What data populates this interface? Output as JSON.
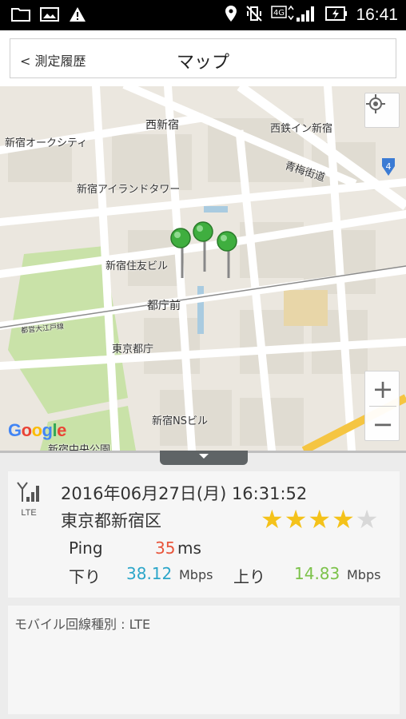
{
  "status_bar": {
    "time": "16:41",
    "network": "4G",
    "left_icons": [
      "folder-icon",
      "image-icon",
      "warning-icon"
    ],
    "right_icons": [
      "location-icon",
      "vibrate-icon",
      "signal-icon",
      "battery-charging-icon"
    ]
  },
  "header": {
    "back_label": "< 測定履歴",
    "title": "マップ"
  },
  "map": {
    "labels": [
      "西新宿",
      "西鉄イン新宿",
      "新宿オークシティ",
      "青梅街道",
      "新宿アイランドタワー",
      "新宿住友ビル",
      "都庁前",
      "都営大江戸線",
      "東京都庁",
      "新宿NSビル",
      "新宿中央公園"
    ],
    "route_badge": "4",
    "pin_count": 3,
    "zoom_in": "+",
    "zoom_out": "−",
    "attribution": "Google",
    "colors": {
      "pin": "#3fae3f",
      "park": "#c9e2a8",
      "road": "#ffffff"
    }
  },
  "result": {
    "network_type": "LTE",
    "datetime": "2016年06月27日(月) 16:31:52",
    "location": "東京都新宿区",
    "rating": 4,
    "rating_max": 5,
    "ping_label": "Ping",
    "ping_value": "35",
    "ping_unit": "ms",
    "down_label": "下り",
    "down_value": "38.12",
    "down_unit": "Mbps",
    "up_label": "上り",
    "up_value": "14.83",
    "up_unit": "Mbps",
    "colors": {
      "ping": "#e8543a",
      "down": "#2ca6c9",
      "up": "#7cc24a",
      "star_on": "#f4c21a",
      "star_off": "#d8d8d8"
    }
  },
  "detail": {
    "mobile_type": "モバイル回線種別 : LTE"
  }
}
